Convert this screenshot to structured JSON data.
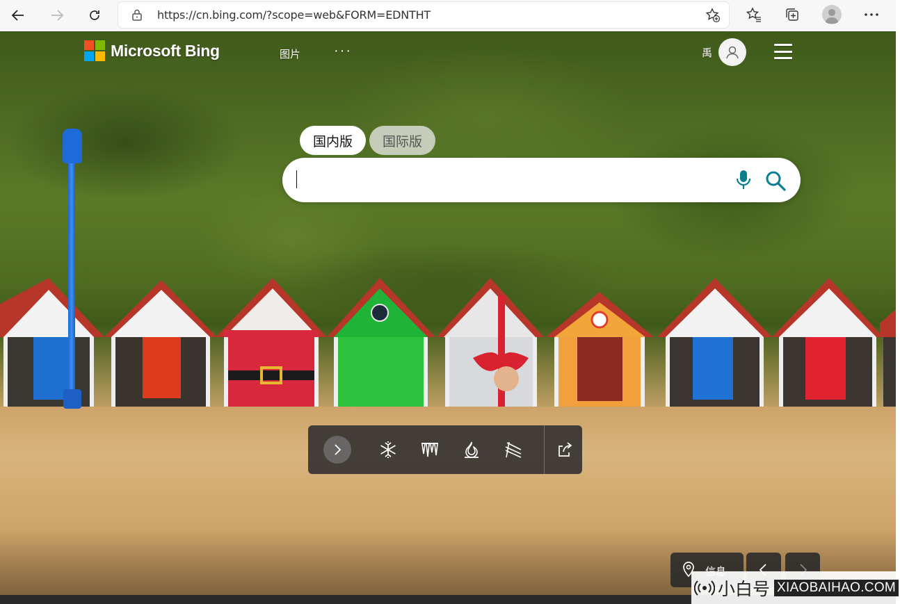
{
  "browser": {
    "url": "https://cn.bing.com/?scope=web&FORM=EDNTHT"
  },
  "header": {
    "brand": "Microsoft Bing",
    "nav_images": "图片",
    "nav_more": "···",
    "user_name": "禹"
  },
  "search": {
    "tab_domestic": "国内版",
    "tab_international": "国际版",
    "query": "",
    "active_tab": "国内版"
  },
  "toolbar": {
    "icons": [
      "chevron-right-icon",
      "snowflake-icon",
      "icicles-icon",
      "fire-icon",
      "feather-icon",
      "share-icon"
    ]
  },
  "footer": {
    "info_label": "信息"
  },
  "watermark": {
    "cn": "小白号",
    "en": "XIAOBAIHAO.COM"
  },
  "colors": {
    "ms_red": "#f25022",
    "ms_green": "#7fba00",
    "ms_blue": "#00a4ef",
    "ms_yellow": "#ffb900",
    "bing_teal": "#0a7d8f",
    "toolbar_bg": "#2d2d2d"
  }
}
